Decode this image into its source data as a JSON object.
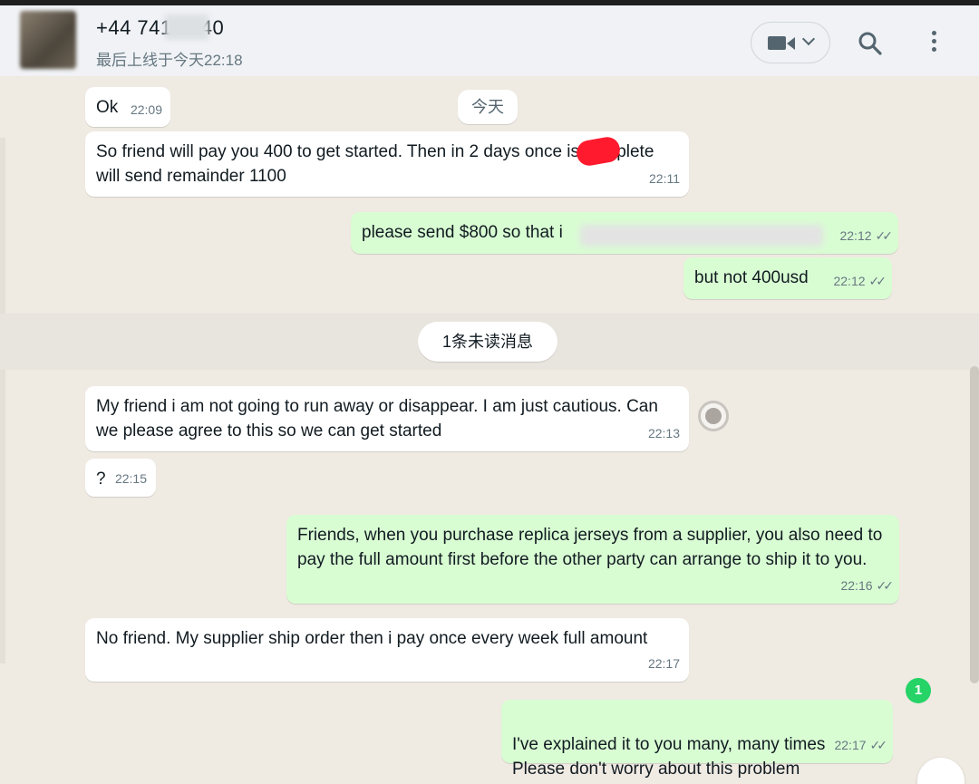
{
  "header": {
    "contact_name": "+44 741      2240",
    "last_seen": "最后上线于今天22:18",
    "video_icon": "video-camera-icon",
    "search_icon": "search-icon",
    "menu_icon": "more-vertical-icon"
  },
  "chat": {
    "date_divider": "今天",
    "unread_divider": "1条未读消息",
    "unread_badge": "1",
    "messages": [
      {
        "dir": "in",
        "text": "Ok",
        "time": "22:09"
      },
      {
        "dir": "in",
        "text": "So friend will pay you 400 to get started. Then in 2 days once      is complete will send remainder 1100",
        "time": "22:11"
      },
      {
        "dir": "out",
        "text": "please send $800  so that i",
        "time": "22:12",
        "ticks": "✓✓"
      },
      {
        "dir": "out",
        "text": "but not 400usd",
        "time": "22:12",
        "ticks": "✓✓"
      },
      {
        "dir": "in",
        "text": "My friend i am not going to run away or disappear. I am just cautious. Can we please agree to this so we can get started",
        "time": "22:13"
      },
      {
        "dir": "in",
        "text": "?",
        "time": "22:15"
      },
      {
        "dir": "out",
        "text": "Friends, when you purchase replica jerseys from a supplier, you also need to pay the full amount first before the other party can arrange to ship it to you.",
        "time": "22:16",
        "ticks": "✓✓"
      },
      {
        "dir": "in",
        "text": "No friend. My supplier ship order then i pay once every week full amount",
        "time": "22:17"
      },
      {
        "dir": "out",
        "text": "I've explained it to you many, many times\nPlease don't worry about this problem",
        "time": "22:17",
        "ticks": "✓✓"
      }
    ]
  },
  "colors": {
    "chat_bg": "#efeae2",
    "incoming_bubble": "#ffffff",
    "outgoing_bubble": "#d9fdd3",
    "header_bg": "#f0f2f5",
    "badge": "#25d366",
    "redaction": "#ff1a2e"
  }
}
